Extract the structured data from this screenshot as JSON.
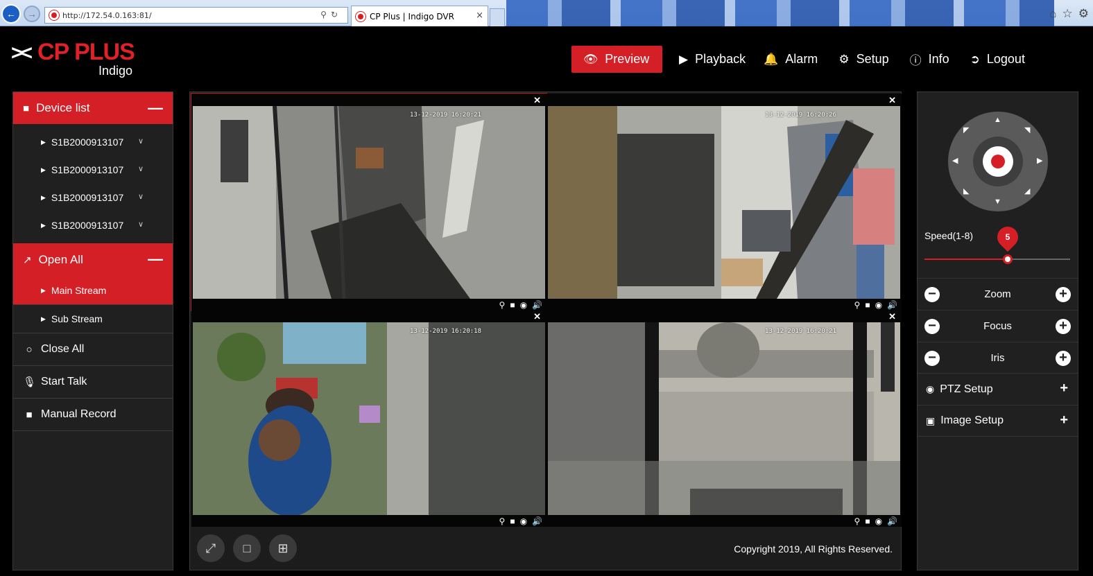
{
  "browser": {
    "url": "http://172.54.0.163:81/",
    "tab_title": "CP Plus | Indigo DVR",
    "tab_close": "×"
  },
  "brand": {
    "logo_text": "CP PLUS",
    "product": "Indigo"
  },
  "nav": [
    {
      "label": "Preview",
      "icon": "eye-icon",
      "active": true
    },
    {
      "label": "Playback",
      "icon": "play-icon"
    },
    {
      "label": "Alarm",
      "icon": "bell-icon"
    },
    {
      "label": "Setup",
      "icon": "gear-icon"
    },
    {
      "label": "Info",
      "icon": "info-icon"
    },
    {
      "label": "Logout",
      "icon": "logout-icon"
    }
  ],
  "sidebar": {
    "device_list_label": "Device list",
    "devices": [
      "S1B2000913107",
      "S1B2000913107",
      "S1B2000913107",
      "S1B2000913107"
    ],
    "open_all_label": "Open All",
    "streams": [
      {
        "label": "Main Stream",
        "active": true
      },
      {
        "label": "Sub Stream",
        "active": false
      }
    ],
    "close_all_label": "Close All",
    "start_talk_label": "Start Talk",
    "manual_record_label": "Manual Record"
  },
  "cameras": [
    {
      "timestamp": "13-12-2019 16:20:21",
      "selected": true
    },
    {
      "timestamp": "13-12-2019 16:20:26",
      "selected": false
    },
    {
      "timestamp": "13-12-2019 16:20:18",
      "selected": false
    },
    {
      "timestamp": "13-12-2019 16:20:21",
      "selected": false
    }
  ],
  "footer": {
    "copyright": "Copyright 2019, All Rights Reserved."
  },
  "ptz": {
    "speed_label": "Speed(1-8)",
    "speed_value": "5",
    "speed_fraction": 0.57,
    "rows": [
      "Zoom",
      "Focus",
      "Iris"
    ],
    "ptz_setup_label": "PTZ Setup",
    "image_setup_label": "Image Setup"
  },
  "colors": {
    "accent": "#d51f26",
    "panel": "#202020",
    "background": "#000000"
  }
}
